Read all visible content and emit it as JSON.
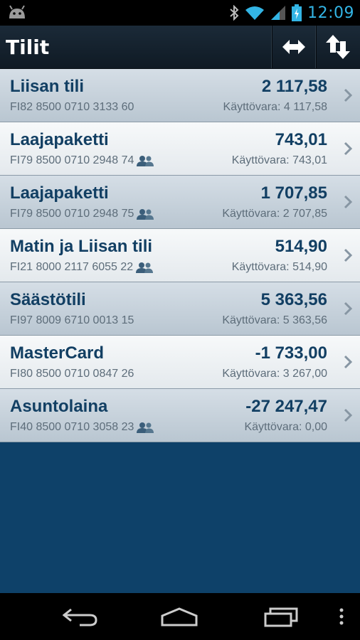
{
  "statusbar": {
    "time": "12:09",
    "icons": [
      "android-icon",
      "bluetooth-icon",
      "wifi-icon",
      "signal-icon",
      "battery-icon"
    ]
  },
  "actionbar": {
    "title": "Tilit",
    "transfer_icon": "transfer-arrows-icon",
    "sort_icon": "sort-arrows-icon"
  },
  "accounts": [
    {
      "name": "Liisan tili",
      "iban": "FI82 8500 0710 3133 60",
      "shared": false,
      "balance": "2 117,58",
      "available": "Käyttövara: 4 117,58"
    },
    {
      "name": "Laajapaketti",
      "iban": "FI79 8500 0710 2948 74",
      "shared": true,
      "balance": "743,01",
      "available": "Käyttövara: 743,01"
    },
    {
      "name": "Laajapaketti",
      "iban": "FI79 8500 0710 2948 75",
      "shared": true,
      "balance": "1 707,85",
      "available": "Käyttövara: 2 707,85"
    },
    {
      "name": "Matin ja Liisan tili",
      "iban": "FI21 8000 2117 6055 22",
      "shared": true,
      "balance": "514,90",
      "available": "Käyttövara: 514,90"
    },
    {
      "name": "Säästötili",
      "iban": "FI97 8009 6710 0013 15",
      "shared": false,
      "balance": "5 363,56",
      "available": "Käyttövara: 5 363,56"
    },
    {
      "name": "MasterCard",
      "iban": "FI80 8500 0710 0847 26",
      "shared": false,
      "balance": "-1 733,00",
      "available": "Käyttövara: 3 267,00"
    },
    {
      "name": "Asuntolaina",
      "iban": "FI40 8500 0710 3058 23",
      "shared": true,
      "balance": "-27 247,47",
      "available": "Käyttövara: 0,00"
    }
  ],
  "colors": {
    "accent_text": "#123f63",
    "background": "#0e4169",
    "clock": "#33b5e5"
  }
}
